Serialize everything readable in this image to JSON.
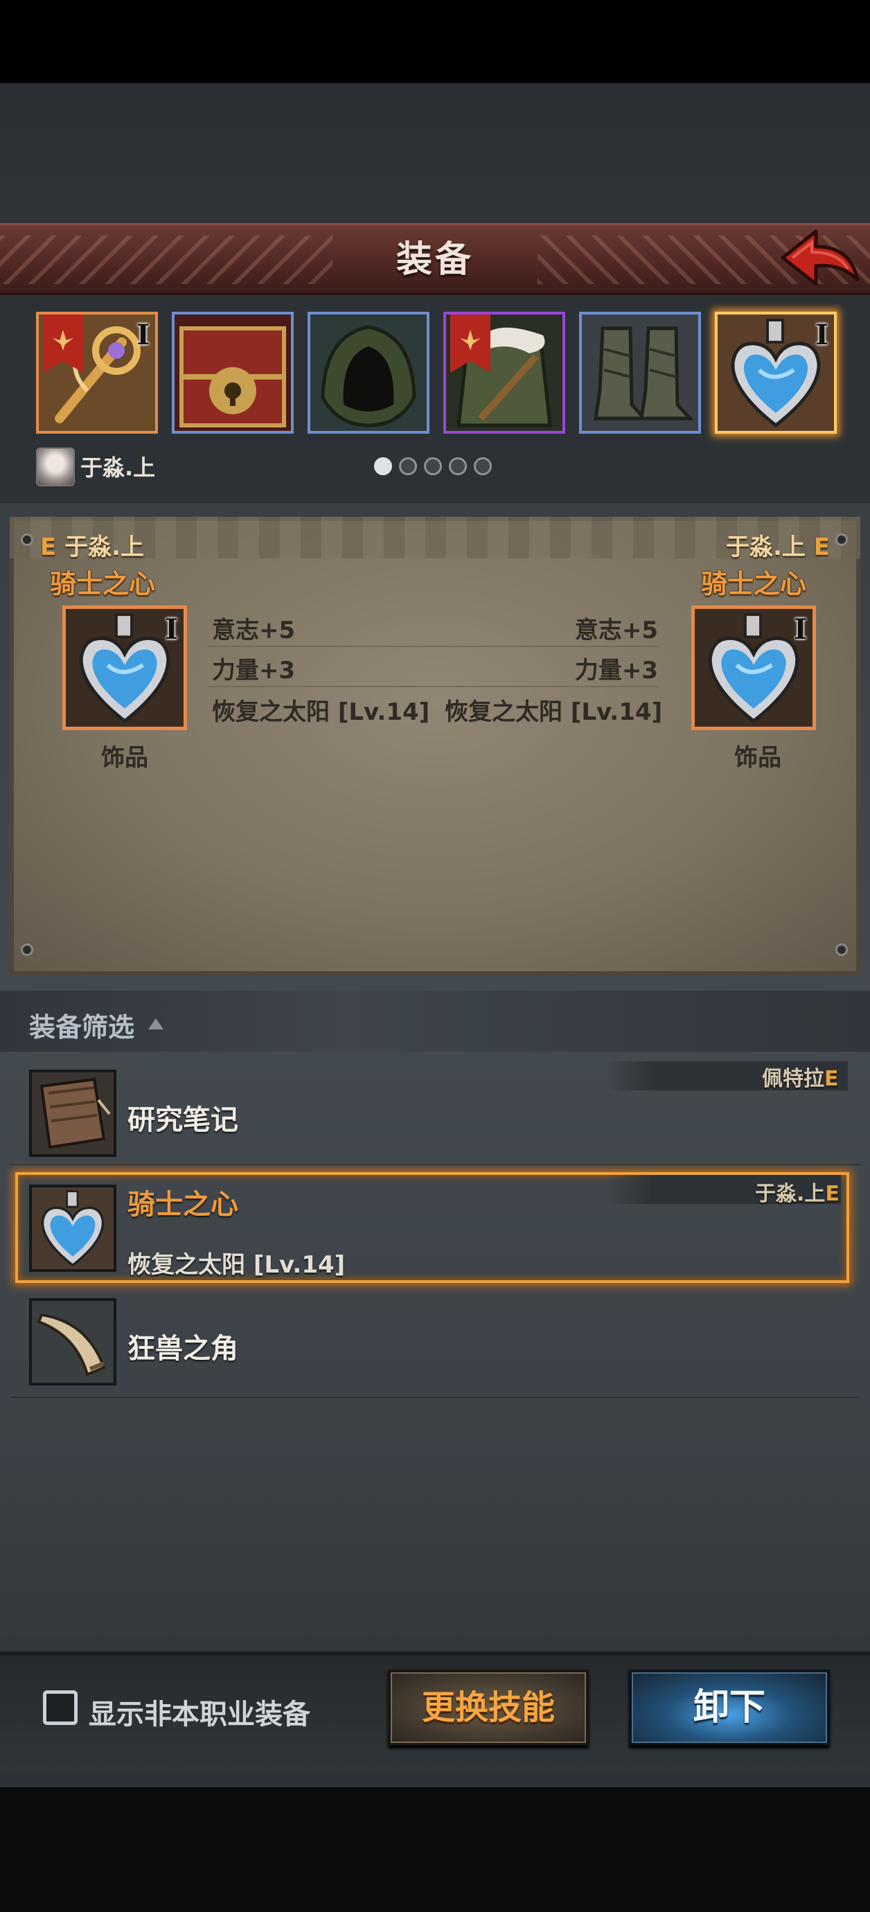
{
  "header": {
    "title": "装备"
  },
  "equipment_slots": [
    {
      "name": "staff",
      "tier": "I",
      "pennant": true,
      "frame": "orange"
    },
    {
      "name": "chest",
      "tier": "",
      "pennant": false,
      "frame": "blue"
    },
    {
      "name": "hood",
      "tier": "",
      "pennant": false,
      "frame": "blue"
    },
    {
      "name": "armor",
      "tier": "",
      "pennant": true,
      "frame": "purple"
    },
    {
      "name": "boots",
      "tier": "",
      "pennant": false,
      "frame": "blue"
    },
    {
      "name": "heart-pendant",
      "tier": "I",
      "pennant": false,
      "frame": "selected"
    }
  ],
  "character": {
    "name": "于淼.上"
  },
  "pagination": {
    "total": 5,
    "current": 1
  },
  "comparison": {
    "left": {
      "grade": "E",
      "owner": "于淼.上",
      "item_name": "骑士之心",
      "tier": "I",
      "category": "饰品",
      "stats": [
        "意志+5",
        "力量+3"
      ],
      "skill": "恢复之太阳 [Lv.14]"
    },
    "right": {
      "grade": "E",
      "owner": "于淼.上",
      "item_name": "骑士之心",
      "tier": "I",
      "category": "饰品",
      "stats": [
        "意志+5",
        "力量+3"
      ],
      "skill": "恢复之太阳 [Lv.14]"
    }
  },
  "filter": {
    "label": "装备筛选"
  },
  "item_list": [
    {
      "name": "研究笔记",
      "owner": "佩特拉",
      "grade": "E",
      "skill": "",
      "selected": false
    },
    {
      "name": "骑士之心",
      "owner": "于淼.上",
      "grade": "E",
      "skill": "恢复之太阳 [Lv.14]",
      "selected": true
    },
    {
      "name": "狂兽之角",
      "owner": "",
      "grade": "",
      "skill": "",
      "selected": false
    }
  ],
  "bottom": {
    "checkbox_label": "显示非本职业装备",
    "checkbox_checked": false,
    "change_skill_label": "更换技能",
    "unequip_label": "卸下"
  },
  "colors": {
    "accent_orange": "#f09a3c",
    "grade_e": "#e8a23d",
    "rare_blue": "#6c8fd0",
    "epic_purple": "#9b45d6"
  }
}
